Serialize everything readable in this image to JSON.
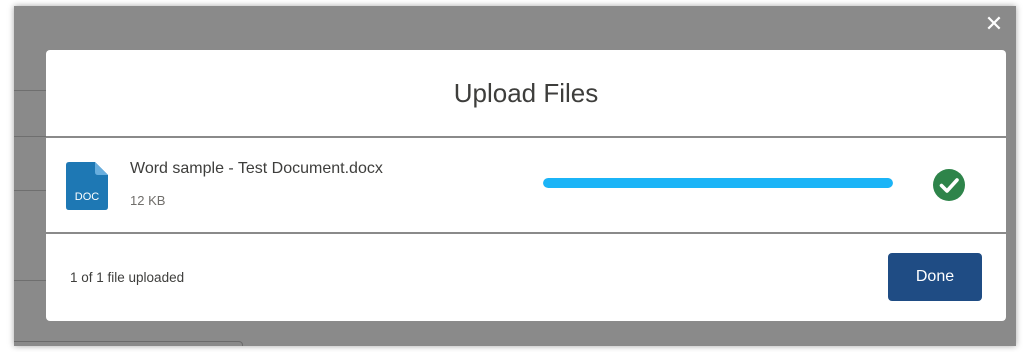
{
  "modal": {
    "title": "Upload Files",
    "close_icon": "close-icon",
    "file": {
      "icon": "doc-file-icon",
      "icon_label": "DOC",
      "name": "Word sample - Test Document.docx",
      "size": "12 KB",
      "progress_percent": 100,
      "status_icon": "check-circle-icon"
    },
    "footer": {
      "status_text": "1 of 1 file uploaded",
      "done_label": "Done"
    }
  },
  "colors": {
    "progress": "#1bb4f7",
    "success": "#2e844a",
    "done_button": "#1f4c84",
    "file_icon": "#1e78b4",
    "overlay": "#8a8a8a"
  }
}
